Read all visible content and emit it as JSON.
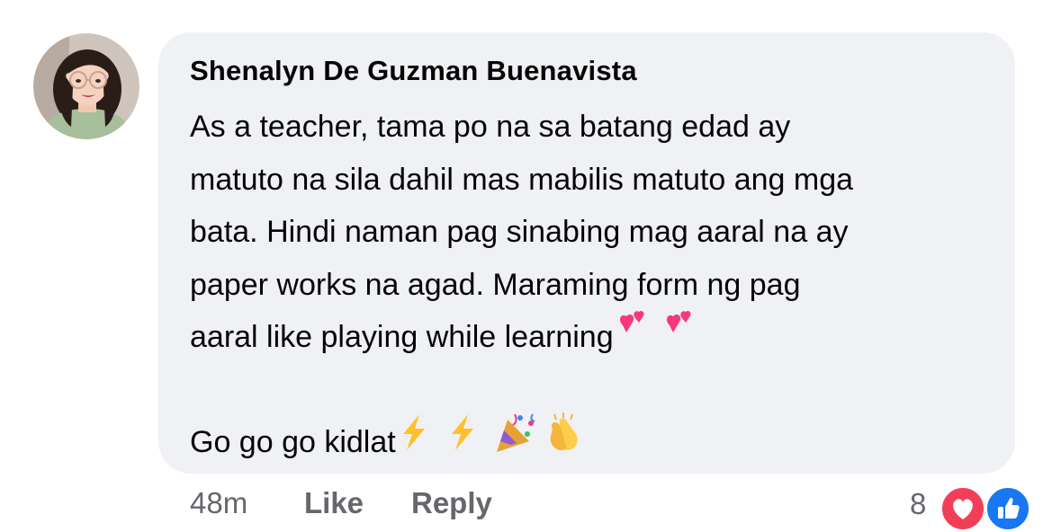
{
  "comment": {
    "author": "Shenalyn De Guzman Buenavista",
    "lines": [
      "As a teacher, tama po na sa batang edad ay",
      "matuto na sila dahil mas mabilis matuto ang mga",
      "bata. Hindi naman pag sinabing mag aaral na ay",
      "paper works na agad. Maraming form ng pag",
      "aaral like playing while learning",
      "Go go go kidlat"
    ],
    "line5_emojis": [
      "two-hearts",
      "two-hearts"
    ],
    "line6_emojis": [
      "lightning",
      "lightning",
      "party-popper",
      "clapping-hands"
    ],
    "bubble_color": "#f0f1f4"
  },
  "actions": {
    "time": "48m",
    "like_label": "Like",
    "reply_label": "Reply"
  },
  "reactions": {
    "count": "8",
    "types": [
      "love",
      "like"
    ],
    "love_color": "#f33e58",
    "like_color": "#1877f2"
  }
}
